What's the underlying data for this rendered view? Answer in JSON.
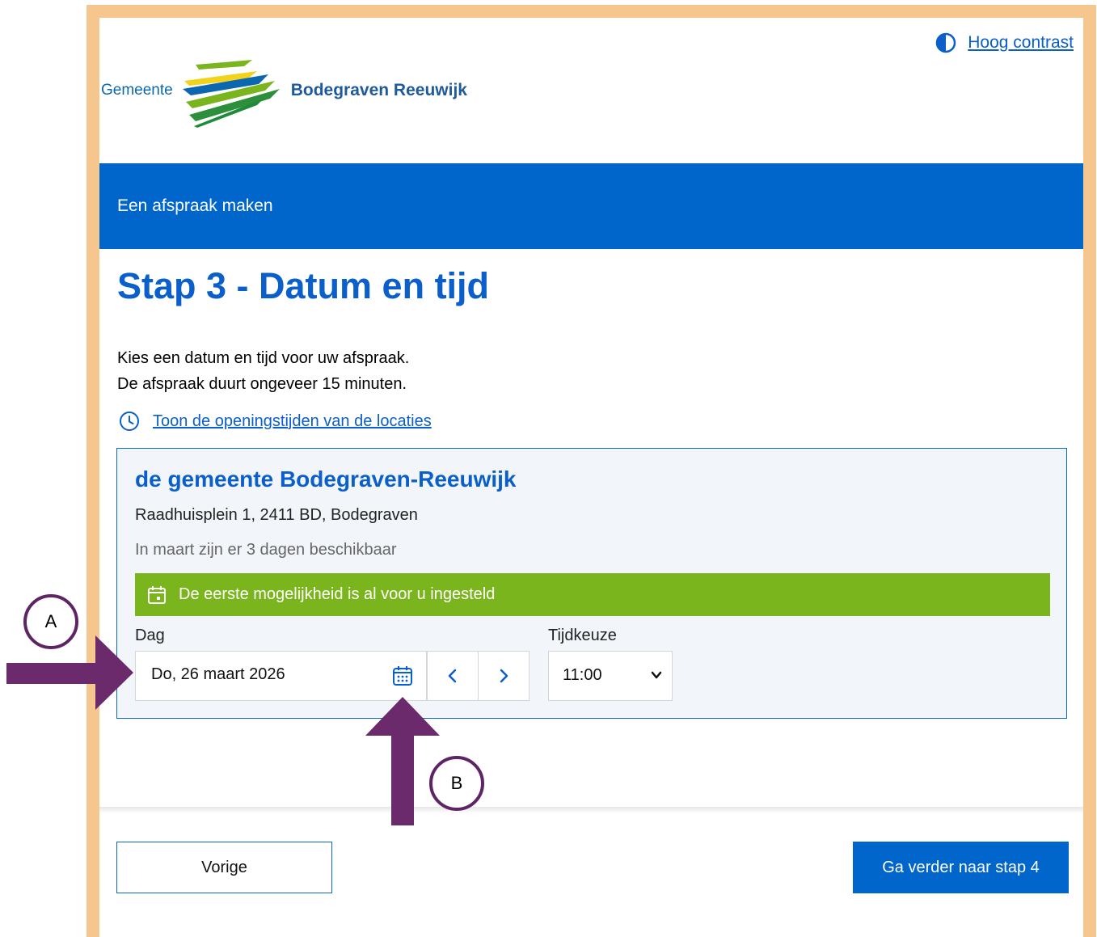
{
  "header": {
    "contrast_label": "Hoog contrast",
    "logo_prefix": "Gemeente",
    "logo_name": "Bodegraven Reeuwijk"
  },
  "banner": {
    "text": "Een afspraak maken"
  },
  "page": {
    "title": "Stap 3 - Datum en tijd",
    "intro_line1": "Kies een datum en tijd voor uw afspraak.",
    "intro_line2": "De afspraak duurt ongeveer 15 minuten.",
    "hours_link": "Toon de openingstijden van de locaties"
  },
  "location": {
    "name": "de gemeente Bodegraven-Reeuwijk",
    "address": "Raadhuisplein 1, 2411 BD, Bodegraven",
    "availability": "In maart zijn er 3 dagen beschikbaar",
    "notice": "De eerste mogelijkheid is al voor u ingesteld"
  },
  "form": {
    "day_label": "Dag",
    "day_value": "Do, 26 maart 2026",
    "time_label": "Tijdkeuze",
    "time_value": "11:00"
  },
  "footer": {
    "prev_label": "Vorige",
    "next_label": "Ga verder naar stap 4"
  },
  "annotations": {
    "marker_a": "A",
    "marker_b": "B",
    "arrow_color": "#6b2a6b"
  },
  "colors": {
    "accent": "#0066cc",
    "notice": "#7ab51d",
    "frame": "#f5c78e"
  }
}
